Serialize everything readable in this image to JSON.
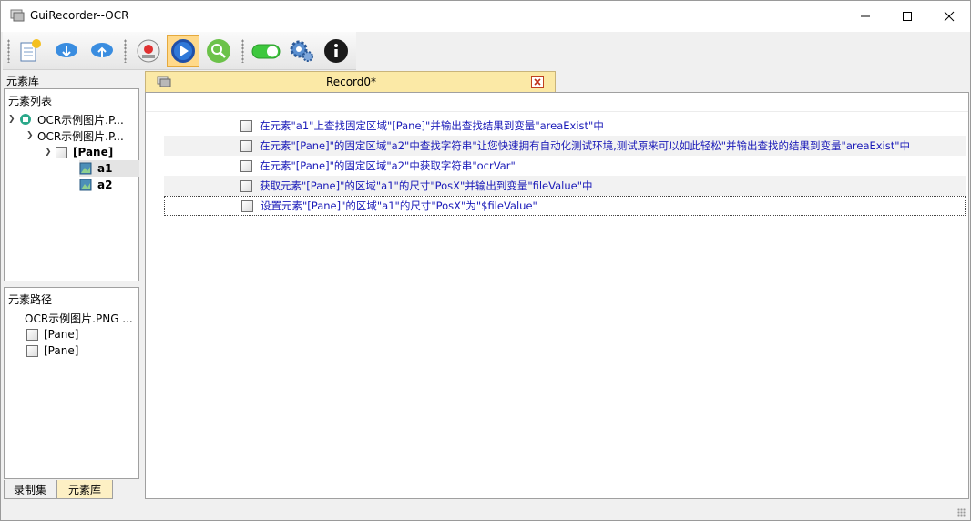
{
  "window": {
    "title": "GuiRecorder--OCR"
  },
  "toolbar": {
    "buttons": [
      {
        "icon": "new-record-icon"
      },
      {
        "icon": "cloud-download-icon"
      },
      {
        "icon": "cloud-upload-icon"
      },
      {
        "icon": "record-rec-icon"
      },
      {
        "icon": "play-icon"
      },
      {
        "icon": "search-icon"
      },
      {
        "icon": "toggle-icon"
      },
      {
        "icon": "settings-icon"
      },
      {
        "icon": "info-icon"
      }
    ]
  },
  "left": {
    "library_label": "元素库",
    "elements_header": "元素列表",
    "tree": [
      {
        "label": "OCR示例图片.P...",
        "level": 0
      },
      {
        "label": "OCR示例图片.P...",
        "level": 1
      },
      {
        "label": "[Pane]",
        "level": 2
      },
      {
        "label": "a1",
        "level": 3
      },
      {
        "label": "a2",
        "level": 3
      }
    ],
    "path_header": "元素路径",
    "path_items": [
      {
        "label": "OCR示例图片.PNG ..."
      },
      {
        "label": "[Pane]"
      },
      {
        "label": "[Pane]"
      }
    ],
    "tabs": [
      {
        "label": "录制集"
      },
      {
        "label": "元素库"
      }
    ]
  },
  "document": {
    "tab_title": "Record0*",
    "steps": [
      {
        "text": "在元素\"a1\"上查找固定区域\"[Pane]\"并输出查找结果到变量\"areaExist\"中"
      },
      {
        "text": "在元素\"[Pane]\"的固定区域\"a2\"中查找字符串\"让您快速拥有自动化测试环境,测试原来可以如此轻松\"并输出查找的结果到变量\"areaExist\"中"
      },
      {
        "text": "在元素\"[Pane]\"的固定区域\"a2\"中获取字符串\"ocrVar\""
      },
      {
        "text": "获取元素\"[Pane]\"的区域\"a1\"的尺寸\"PosX\"并输出到变量\"fileValue\"中"
      },
      {
        "text": "设置元素\"[Pane]\"的区域\"a1\"的尺寸\"PosX\"为\"$fileValue\""
      }
    ]
  },
  "colors": {
    "step_text": "#1a1ab8",
    "tab_bg": "#fbe9a6",
    "active_button": "#ffd98a"
  }
}
